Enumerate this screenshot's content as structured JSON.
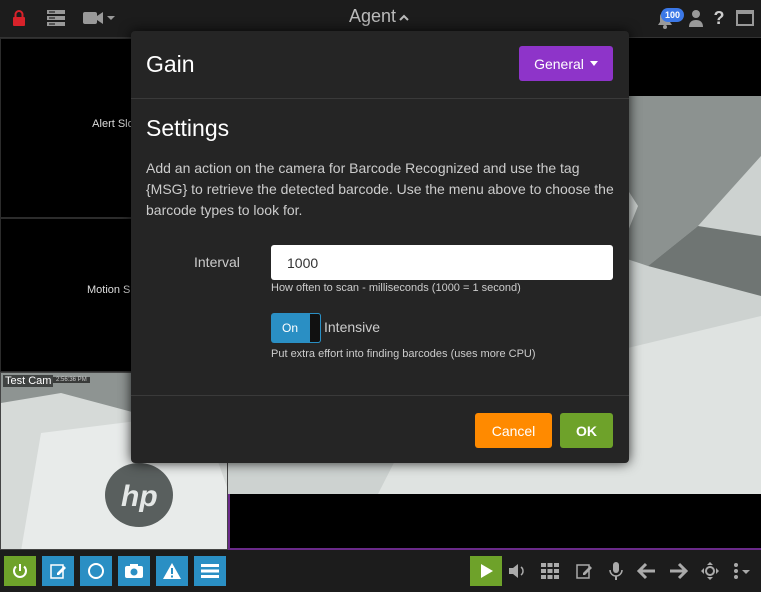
{
  "header": {
    "title": "Agent",
    "notification_count": "100"
  },
  "grid": {
    "alert_slot_label": "Alert Slot",
    "motion_slot_label": "Motion Slot",
    "camera_label": "Test Cam",
    "camera_timestamp": "2:56:36 PM"
  },
  "modal": {
    "title": "Gain",
    "menu_button_label": "General",
    "section_title": "Settings",
    "description": "Add an action on the camera for Barcode Recognized and use the tag {MSG} to retrieve the detected barcode. Use the menu above to choose the barcode types to look for.",
    "interval": {
      "label": "Interval",
      "value": "1000",
      "help": "How often to scan - milliseconds (1000 = 1 second)"
    },
    "intensive": {
      "state_label": "On",
      "label": "Intensive",
      "help": "Put extra effort into finding barcodes (uses more CPU)"
    },
    "cancel_label": "Cancel",
    "ok_label": "OK"
  },
  "colors": {
    "accent_purple": "#8e34c9",
    "toggle_blue": "#2a8fc4",
    "cancel_orange": "#ff8a00",
    "ok_green": "#6ea22a"
  }
}
